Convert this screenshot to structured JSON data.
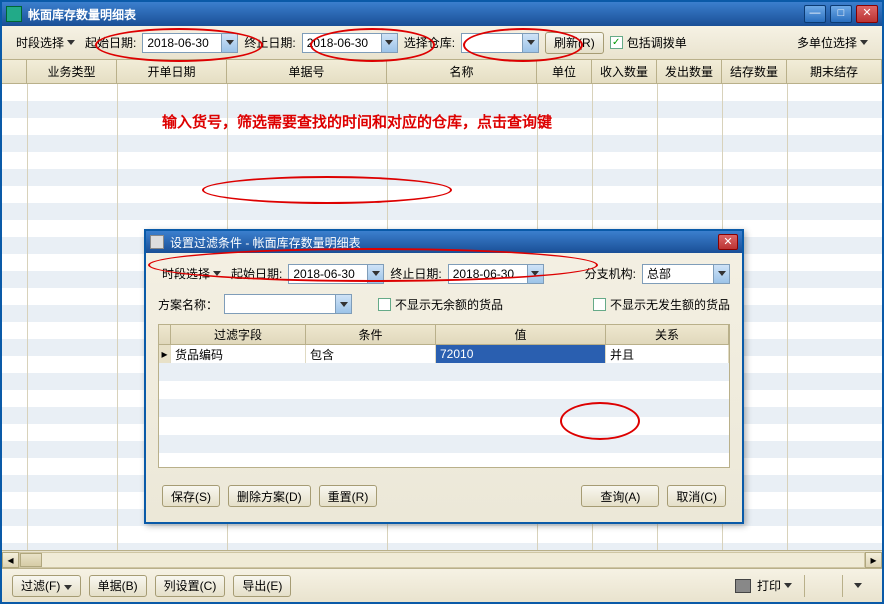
{
  "window": {
    "title": "帐面库存数量明细表"
  },
  "toolbar": {
    "period_label": "时段选择",
    "start_date_label": "起始日期:",
    "start_date": "2018-06-30",
    "end_date_label": "终止日期:",
    "end_date": "2018-06-30",
    "warehouse_label": "选择仓库:",
    "warehouse": "",
    "refresh": "刷新(R)",
    "include_transfer": "包括调拨单",
    "multi_unit": "多单位选择"
  },
  "columns": [
    "业务类型",
    "开单日期",
    "单据号",
    "名称",
    "单位",
    "收入数量",
    "发出数量",
    "结存数量",
    "期末结存"
  ],
  "annotation": "输入货号，筛选需要查找的时间和对应的仓库，点击查询键",
  "dialog": {
    "title": "设置过滤条件 - 帐面库存数量明细表",
    "period_label": "时段选择",
    "start_date_label": "起始日期:",
    "start_date": "2018-06-30",
    "end_date_label": "终止日期:",
    "end_date": "2018-06-30",
    "branch_label": "分支机构:",
    "branch": "总部",
    "scheme_label": "方案名称：",
    "scheme": "",
    "hide_zero_balance": "不显示无余额的货品",
    "hide_no_transaction": "不显示无发生额的货品",
    "filter_columns": [
      "过滤字段",
      "条件",
      "值",
      "关系"
    ],
    "filter_row": {
      "field": "货品编码",
      "op": "包含",
      "value": "72010",
      "rel": "并且"
    },
    "buttons": {
      "save": "保存(S)",
      "delete_scheme": "删除方案(D)",
      "reset": "重置(R)",
      "query": "查询(A)",
      "cancel": "取消(C)"
    }
  },
  "bottom": {
    "filter": "过滤(F)",
    "doc": "单据(B)",
    "col_settings": "列设置(C)",
    "export": "导出(E)",
    "print": "打印"
  }
}
